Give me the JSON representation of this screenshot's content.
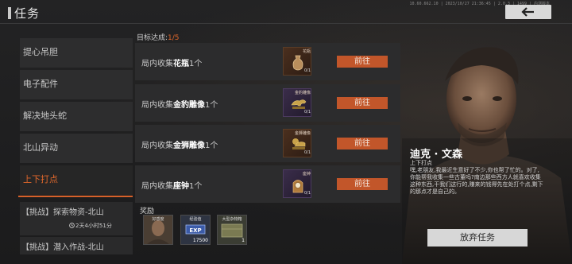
{
  "header": {
    "title": "任务",
    "info": "10.60.662.10 | 2023/10/27 21:36:45 | 2.0.3 | 1499 | 内测版本"
  },
  "sidebar": {
    "items": [
      {
        "label": "提心吊胆"
      },
      {
        "label": "电子配件"
      },
      {
        "label": "解决地头蛇"
      },
      {
        "label": "北山异动"
      },
      {
        "label": "上下打点"
      }
    ],
    "challenge1": {
      "label": "【挑战】探索物资-北山",
      "time": "2天4小时51分"
    },
    "challenge2": {
      "label": "【挑战】潜入作战-北山"
    }
  },
  "objectives": {
    "label": "目标达成:",
    "progress": "1/5",
    "tasks": [
      {
        "prefix": "局内收集",
        "item": "花瓶",
        "qty": "1个",
        "thumb_label": "花瓶",
        "thumb_progress": "0/1",
        "button": "前往",
        "thumb_icon": "vase-icon"
      },
      {
        "prefix": "局内收集",
        "item": "金豹雕像",
        "qty": "1个",
        "thumb_label": "金豹雕像",
        "thumb_progress": "0/1",
        "button": "前往",
        "thumb_icon": "leopard-statue-icon"
      },
      {
        "prefix": "局内收集",
        "item": "金狮雕像",
        "qty": "1个",
        "thumb_label": "金狮雕像",
        "thumb_progress": "0/1",
        "button": "前往",
        "thumb_icon": "lion-statue-icon"
      },
      {
        "prefix": "局内收集",
        "item": "座钟",
        "qty": "1个",
        "thumb_label": "座钟",
        "thumb_progress": "0/1",
        "button": "前往",
        "thumb_icon": "mantel-clock-icon"
      }
    ]
  },
  "rewards": {
    "label": "奖励",
    "items": [
      {
        "label": "好感度",
        "amount": "",
        "icon": "portrait-icon"
      },
      {
        "label": "经验值",
        "amount": "17500",
        "icon": "exp-icon"
      },
      {
        "label": "大型杂物箱",
        "amount": "1",
        "icon": "crate-icon"
      }
    ]
  },
  "character": {
    "name": "迪克 · 文森",
    "title": "上下打点",
    "description": "嘿,老朋友,我最近生意好了不少,你也帮了忙的。对了,你能帮我收集一些古董吗?南边那些西方人就喜欢收集这种东西,干我们这行的,赚来的钱得先在处打个点,剩下的那点才是自己的。"
  },
  "actions": {
    "abandon": "放弃任务"
  },
  "colors": {
    "accent": "#e0672b",
    "button": "#c2562a",
    "panel": "#2c2c2d"
  }
}
